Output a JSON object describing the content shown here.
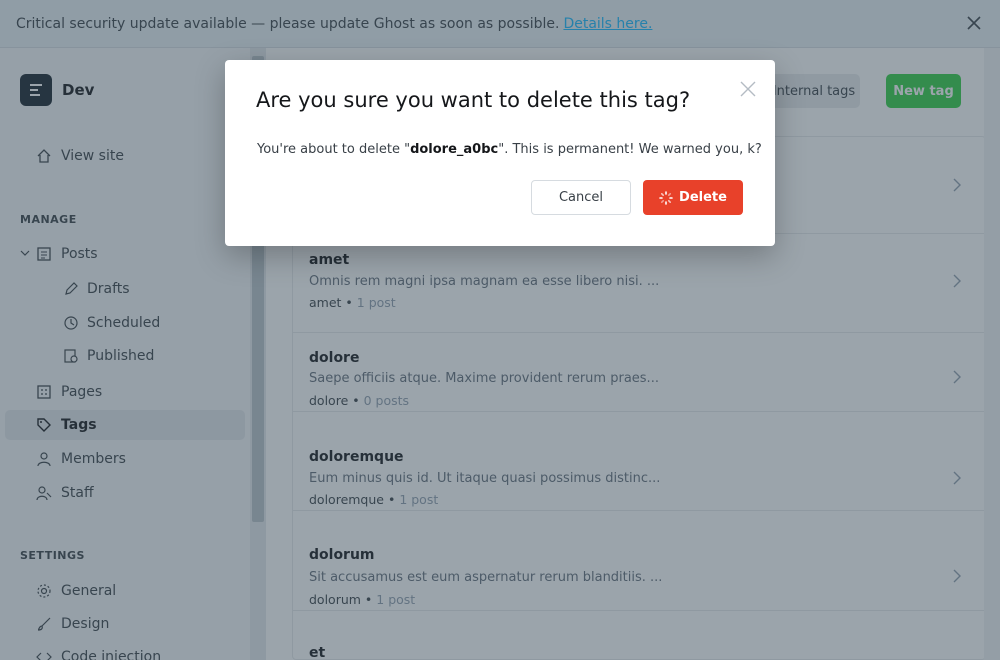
{
  "banner": {
    "text": "Critical security update available — please update Ghost as soon as possible.",
    "link": "Details here."
  },
  "sidebar": {
    "site_name": "Dev",
    "view_site": "View site",
    "manage_heading": "MANAGE",
    "posts": "Posts",
    "drafts": "Drafts",
    "scheduled": "Scheduled",
    "published": "Published",
    "pages": "Pages",
    "tags": "Tags",
    "members": "Members",
    "staff": "Staff",
    "settings_heading": "SETTINGS",
    "general": "General",
    "design": "Design",
    "code_injection": "Code injection"
  },
  "header": {
    "internal_tags": "Internal tags",
    "new_tag": "New tag"
  },
  "tags": [
    {
      "name": "amet",
      "description": "Omnis rem magni ipsa magnam ea esse libero nisi. ...",
      "slug": "amet",
      "count": "1 post"
    },
    {
      "name": "dolore",
      "description": "Saepe officiis atque. Maxime provident rerum praes...",
      "slug": "dolore",
      "count": "0 posts"
    },
    {
      "name": "doloremque",
      "description": "Eum minus quis id. Ut itaque quasi possimus distinc...",
      "slug": "doloremque",
      "count": "1 post"
    },
    {
      "name": "dolorum",
      "description": "Sit accusamus est eum aspernatur rerum blanditiis. ...",
      "slug": "dolorum",
      "count": "1 post"
    },
    {
      "name": "et",
      "description": "",
      "slug": "",
      "count": ""
    }
  ],
  "modal": {
    "title": "Are you sure you want to delete this tag?",
    "body_prefix": "You're about to delete \"",
    "tag_name": "dolore_a0bc",
    "body_suffix": "\". This is permanent! We warned you, k?",
    "cancel": "Cancel",
    "delete": "Delete"
  },
  "colors": {
    "accent_green": "#30cf43",
    "danger_red": "#e8412a",
    "link_blue": "#14b8ff"
  }
}
